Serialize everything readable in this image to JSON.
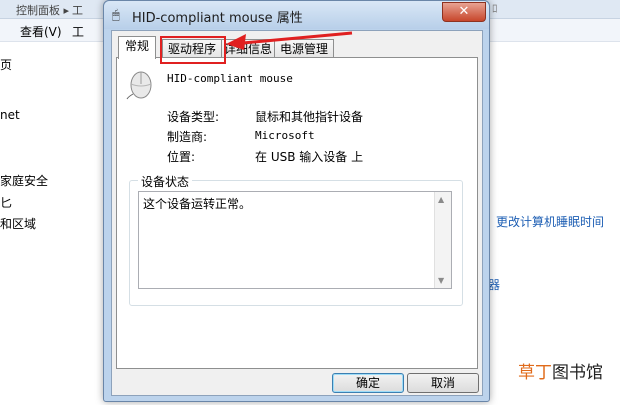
{
  "background": {
    "topbar": {
      "breadcrumb": "控制面板 ▸",
      "tool": "工",
      "right": "ﾛ"
    },
    "menubar": {
      "view": "查看(V)",
      "tools": "工"
    },
    "left_items": [
      "页",
      "net",
      "家庭安全",
      "匕",
      "和区域"
    ],
    "links": {
      "sleep": "更改计算机睡眠时间",
      "device": "器"
    }
  },
  "dialog": {
    "title": "HID-compliant mouse 属性",
    "close_label": "✕",
    "tabs": [
      {
        "label": "常规",
        "active": true
      },
      {
        "label": "驱动程序",
        "active": false,
        "highlighted": true
      },
      {
        "label": "详细信息",
        "active": false
      },
      {
        "label": "电源管理",
        "active": false
      }
    ],
    "device_name": "HID-compliant mouse",
    "properties": [
      {
        "label": "设备类型:",
        "value": "鼠标和其他指针设备"
      },
      {
        "label": "制造商:",
        "value": "Microsoft"
      },
      {
        "label": "位置:",
        "value": "在 USB 输入设备 上"
      }
    ],
    "status_legend": "设备状态",
    "status_text": "这个设备运转正常。",
    "buttons": {
      "ok": "确定",
      "cancel": "取消"
    }
  },
  "watermark": {
    "part1": "草丁",
    "part2": "图书馆"
  },
  "colors": {
    "highlight": "#e02020",
    "link": "#1e5fb4",
    "dialog_frame": "#bcd3ec"
  },
  "icons": {
    "title": "mouse-icon",
    "close": "close-icon",
    "device": "mouse-icon"
  }
}
